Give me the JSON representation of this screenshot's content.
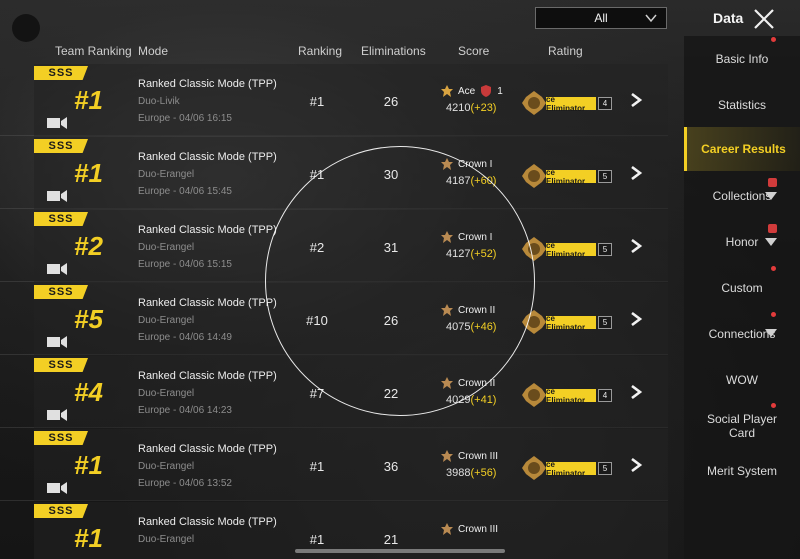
{
  "header": {
    "filter_value": "All",
    "title": "Data"
  },
  "columns": {
    "team_ranking": "Team Ranking",
    "mode": "Mode",
    "ranking": "Ranking",
    "eliminations": "Eliminations",
    "score": "Score",
    "rating": "Rating"
  },
  "matches": [
    {
      "grade": "SSS",
      "team_rank": "#1",
      "mode": "Ranked Classic Mode (TPP)",
      "map": "Duo-Livik",
      "time": "Europe - 04/06 16:15",
      "ranking": "#1",
      "eliminations": "26",
      "tier": "Ace",
      "tier_extra": "1",
      "score": "4210",
      "delta": "(+23)",
      "rating_label": "ce Eliminator",
      "rating_level": "4"
    },
    {
      "grade": "SSS",
      "team_rank": "#1",
      "mode": "Ranked Classic Mode (TPP)",
      "map": "Duo-Erangel",
      "time": "Europe - 04/06 15:45",
      "ranking": "#1",
      "eliminations": "30",
      "tier": "Crown I",
      "tier_extra": "",
      "score": "4187",
      "delta": "(+60)",
      "rating_label": "ce Eliminator",
      "rating_level": "5"
    },
    {
      "grade": "SSS",
      "team_rank": "#2",
      "mode": "Ranked Classic Mode (TPP)",
      "map": "Duo-Erangel",
      "time": "Europe - 04/06 15:15",
      "ranking": "#2",
      "eliminations": "31",
      "tier": "Crown I",
      "tier_extra": "",
      "score": "4127",
      "delta": "(+52)",
      "rating_label": "ce Eliminator",
      "rating_level": "5"
    },
    {
      "grade": "SSS",
      "team_rank": "#5",
      "mode": "Ranked Classic Mode (TPP)",
      "map": "Duo-Erangel",
      "time": "Europe - 04/06 14:49",
      "ranking": "#10",
      "eliminations": "26",
      "tier": "Crown II",
      "tier_extra": "",
      "score": "4075",
      "delta": "(+46)",
      "rating_label": "ce Eliminator",
      "rating_level": "5"
    },
    {
      "grade": "SSS",
      "team_rank": "#4",
      "mode": "Ranked Classic Mode (TPP)",
      "map": "Duo-Erangel",
      "time": "Europe - 04/06 14:23",
      "ranking": "#7",
      "eliminations": "22",
      "tier": "Crown II",
      "tier_extra": "",
      "score": "4029",
      "delta": "(+41)",
      "rating_label": "ce Eliminator",
      "rating_level": "4"
    },
    {
      "grade": "SSS",
      "team_rank": "#1",
      "mode": "Ranked Classic Mode (TPP)",
      "map": "Duo-Erangel",
      "time": "Europe - 04/06 13:52",
      "ranking": "#1",
      "eliminations": "36",
      "tier": "Crown III",
      "tier_extra": "",
      "score": "3988",
      "delta": "(+56)",
      "rating_label": "ce Eliminator",
      "rating_level": "5"
    },
    {
      "grade": "SSS",
      "team_rank": "#1",
      "mode": "Ranked Classic Mode (TPP)",
      "map": "Duo-Erangel",
      "time": "",
      "ranking": "#1",
      "eliminations": "21",
      "tier": "Crown III",
      "tier_extra": "",
      "score": "",
      "delta": "",
      "rating_label": "",
      "rating_level": ""
    }
  ],
  "sidebar": {
    "items": [
      {
        "label": "Basic Info"
      },
      {
        "label": "Statistics"
      },
      {
        "label": "Career Results"
      },
      {
        "label": "Collections"
      },
      {
        "label": "Honor"
      },
      {
        "label": "Custom"
      },
      {
        "label": "Connections"
      },
      {
        "label": "WOW"
      },
      {
        "label": "Social Player Card"
      },
      {
        "label": "Merit System"
      }
    ]
  },
  "colors": {
    "accent_yellow": "#f3cf24",
    "notification_red": "#e23b3b"
  }
}
